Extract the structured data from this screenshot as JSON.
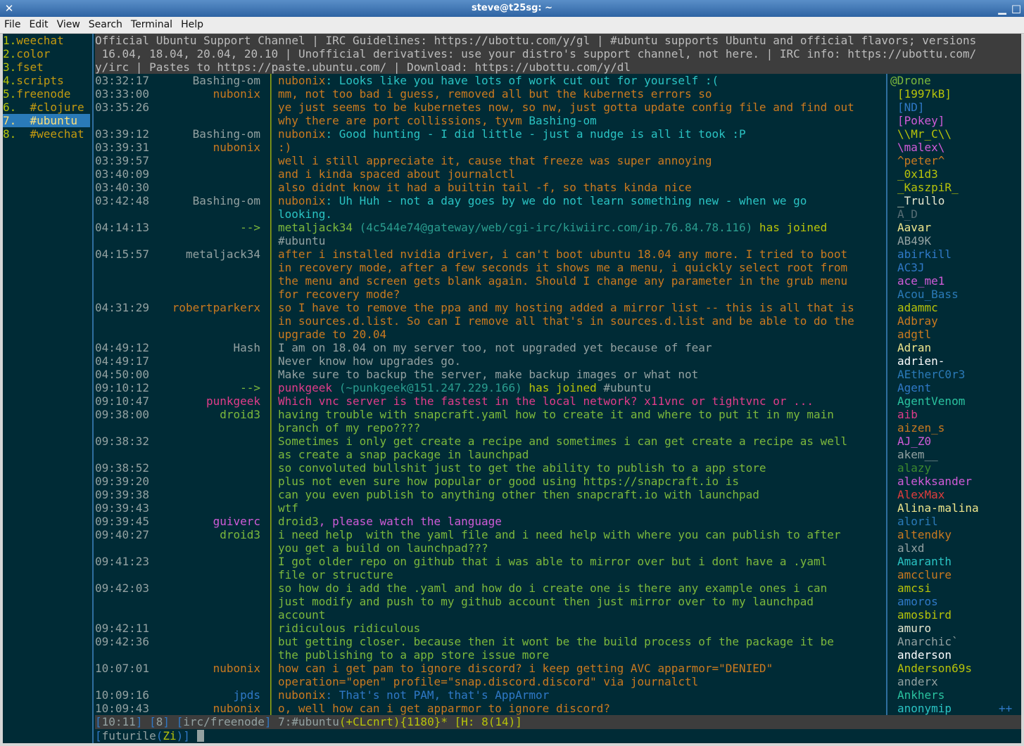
{
  "window": {
    "title": "steve@t25sg: ~"
  },
  "menu": [
    "File",
    "Edit",
    "View",
    "Search",
    "Terminal",
    "Help"
  ],
  "buffers": [
    {
      "num": "1.",
      "name": "weechat"
    },
    {
      "num": "2.",
      "name": "color"
    },
    {
      "num": "3.",
      "name": "fset"
    },
    {
      "num": "4.",
      "name": "scripts"
    },
    {
      "num": "5.",
      "name": "freenode"
    },
    {
      "num": "6.",
      "name": "  #clojure"
    },
    {
      "num": "7.",
      "name": "  #ubuntu ",
      "active": true
    },
    {
      "num": "8.",
      "name": "  #weechat"
    }
  ],
  "topic": [
    "Official Ubuntu Support Channel | IRC Guidelines: https://ubottu.com/y/gl | #ubuntu supports Ubuntu and official flavors; versions",
    " 16.04, 18.04, 20.04, 20.10 | Unofficial derivatives: use your distro's support channel, not here. | IRC info: https://ubottu.com/",
    "y/irc | Pastes to https://paste.ubuntu.com/ | Download: https://ubottu.com/y/dl"
  ],
  "lines": [
    {
      "t": "03:32:17",
      "n": "Bashing-om",
      "nc": "c-bash",
      "m": [
        [
          "nubonix",
          "c-nub"
        ],
        [
          ": Looks like you have lots of work cut out for yourself :(",
          "c-cyan"
        ]
      ]
    },
    {
      "t": "03:33:00",
      "n": "nubonix",
      "nc": "c-nub",
      "m": [
        [
          "mm, not too bad i guess, removed all but the kubernets errors so",
          "c-nub"
        ]
      ]
    },
    {
      "t": "03:35:26",
      "n": "",
      "nc": "c-nub",
      "m": [
        [
          "ye just seems to be kubernetes now, so nw, just gotta update config file and find out",
          "c-nub"
        ]
      ]
    },
    {
      "t": "",
      "n": "",
      "nc": "c-nub",
      "m": [
        [
          "why there are port collissions, tyvm ",
          "c-nub"
        ],
        [
          "Bashing-om",
          "c-hl"
        ]
      ]
    },
    {
      "t": "03:39:12",
      "n": "Bashing-om",
      "nc": "c-bash",
      "m": [
        [
          "nubonix",
          "c-nub"
        ],
        [
          ": Good hunting - I did little - just a nudge is all it took :P",
          "c-cyan"
        ]
      ]
    },
    {
      "t": "03:39:31",
      "n": "nubonix",
      "nc": "c-nub",
      "m": [
        [
          ":)",
          "c-nub"
        ]
      ]
    },
    {
      "t": "03:39:57",
      "n": "",
      "nc": "c-nub",
      "m": [
        [
          "well i still appreciate it, cause that freeze was super annoying",
          "c-nub"
        ]
      ]
    },
    {
      "t": "03:40:09",
      "n": "",
      "nc": "c-nub",
      "m": [
        [
          "and i kinda spaced about journalctl",
          "c-nub"
        ]
      ]
    },
    {
      "t": "03:40:30",
      "n": "",
      "nc": "c-nub",
      "m": [
        [
          "also didnt know it had a builtin tail -f, so thats kinda nice",
          "c-nub"
        ]
      ]
    },
    {
      "t": "03:42:48",
      "n": "Bashing-om",
      "nc": "c-bash",
      "m": [
        [
          "nubonix",
          "c-nub"
        ],
        [
          ": Uh Huh - not a day goes by we do not learn something new - when we go",
          "c-cyan"
        ]
      ]
    },
    {
      "t": "",
      "n": "",
      "nc": "c-bash",
      "m": [
        [
          "looking.",
          "c-cyan"
        ]
      ]
    },
    {
      "t": "04:14:13",
      "n": "-->",
      "nc": "c-arrow",
      "m": [
        [
          "metaljack34 ",
          "c-droid"
        ],
        [
          "(4c544e74@gateway/web/cgi-irc/kiwiirc.com/ip.76.84.78.116)",
          "c-join-host"
        ],
        [
          " has joined",
          "c-join"
        ]
      ]
    },
    {
      "t": "",
      "n": "",
      "nc": "c-arrow",
      "m": [
        [
          "#ubuntu",
          "c-grey"
        ]
      ]
    },
    {
      "t": "04:15:57",
      "n": "metaljack34",
      "nc": "c-metal",
      "m": [
        [
          "after i installed nvidia driver, i can't boot ubuntu 18.04 any more. I tried to boot",
          "c-nub"
        ]
      ]
    },
    {
      "t": "",
      "n": "",
      "nc": "c-metal",
      "m": [
        [
          "in recovery mode, after a few seconds it shows me a menu, i quickly select root from",
          "c-nub"
        ]
      ]
    },
    {
      "t": "",
      "n": "",
      "nc": "c-metal",
      "m": [
        [
          "the menu and screen gets blank again. Should I change any parameter in the grub menu",
          "c-nub"
        ]
      ]
    },
    {
      "t": "",
      "n": "",
      "nc": "c-metal",
      "m": [
        [
          "for recovery mode?",
          "c-nub"
        ]
      ]
    },
    {
      "t": "04:31:29",
      "n": "robertparkerx",
      "nc": "c-rob",
      "m": [
        [
          "so I have to remove the ppa and my hosting added a mirror list -- this is all that is",
          "c-nub"
        ]
      ]
    },
    {
      "t": "",
      "n": "",
      "nc": "c-rob",
      "m": [
        [
          "in sources.d.list. So can I remove all that's in sources.d.list and be able to do the",
          "c-nub"
        ]
      ]
    },
    {
      "t": "",
      "n": "",
      "nc": "c-rob",
      "m": [
        [
          "upgrade to 20.04",
          "c-nub"
        ]
      ]
    },
    {
      "t": "04:49:12",
      "n": "Hash",
      "nc": "c-hash",
      "m": [
        [
          "I am on 18.04 on my server too, not upgraded yet because of fear",
          "c-grey"
        ]
      ]
    },
    {
      "t": "04:49:17",
      "n": "",
      "nc": "c-hash",
      "m": [
        [
          "Never know how upgrades go.",
          "c-grey"
        ]
      ]
    },
    {
      "t": "04:50:00",
      "n": "",
      "nc": "c-hash",
      "m": [
        [
          "Make sure to backup the server, make backup images or what not",
          "c-grey"
        ]
      ]
    },
    {
      "t": "09:10:12",
      "n": "-->",
      "nc": "c-arrow",
      "m": [
        [
          "punkgeek ",
          "c-punk"
        ],
        [
          "(~punkgeek@151.247.229.166)",
          "c-join-host"
        ],
        [
          " has joined ",
          "c-join"
        ],
        [
          "#ubuntu",
          "c-grey"
        ]
      ]
    },
    {
      "t": "09:10:47",
      "n": "punkgeek",
      "nc": "c-punk",
      "m": [
        [
          "Which vnc server is the fastest in the local network? x11vnc or tightvnc or ...",
          "c-punk"
        ]
      ]
    },
    {
      "t": "09:38:00",
      "n": "droid3",
      "nc": "c-droid",
      "m": [
        [
          "having trouble with snapcraft.yaml how to create it and where to put it in my main",
          "c-droid"
        ]
      ]
    },
    {
      "t": "",
      "n": "",
      "nc": "c-droid",
      "m": [
        [
          "branch of my repo????",
          "c-droid"
        ]
      ]
    },
    {
      "t": "09:38:32",
      "n": "",
      "nc": "c-droid",
      "m": [
        [
          "Sometimes i only get create a recipe and sometimes i can get create a recipe as well",
          "c-droid"
        ]
      ]
    },
    {
      "t": "",
      "n": "",
      "nc": "c-droid",
      "m": [
        [
          "as create a snap package in launchpad",
          "c-droid"
        ]
      ]
    },
    {
      "t": "09:38:52",
      "n": "",
      "nc": "c-droid",
      "m": [
        [
          "so convoluted bullshit just to get the ability to publish to a app store",
          "c-droid"
        ]
      ]
    },
    {
      "t": "09:39:20",
      "n": "",
      "nc": "c-droid",
      "m": [
        [
          "plus not even sure how popular or good using https://snapcraft.io is",
          "c-droid"
        ]
      ]
    },
    {
      "t": "09:39:38",
      "n": "",
      "nc": "c-droid",
      "m": [
        [
          "can you even publish to anything other then snapcraft.io with launchpad",
          "c-droid"
        ]
      ]
    },
    {
      "t": "09:39:43",
      "n": "",
      "nc": "c-droid",
      "m": [
        [
          "wtf",
          "c-droid"
        ]
      ]
    },
    {
      "t": "09:39:45",
      "n": "guiverc",
      "nc": "c-gui",
      "m": [
        [
          "droid3",
          "c-droid"
        ],
        [
          ", please watch the language",
          "c-gui"
        ]
      ]
    },
    {
      "t": "09:40:27",
      "n": "droid3",
      "nc": "c-droid",
      "m": [
        [
          "i need help  with the yaml file and i need help with where you can publish to after",
          "c-droid"
        ]
      ]
    },
    {
      "t": "",
      "n": "",
      "nc": "c-droid",
      "m": [
        [
          "you get a build on launchpad???",
          "c-droid"
        ]
      ]
    },
    {
      "t": "09:41:23",
      "n": "",
      "nc": "c-droid",
      "m": [
        [
          "I got older repo on github that i was able to mirror over but i dont have a .yaml",
          "c-droid"
        ]
      ]
    },
    {
      "t": "",
      "n": "",
      "nc": "c-droid",
      "m": [
        [
          "file or structure",
          "c-droid"
        ]
      ]
    },
    {
      "t": "09:42:03",
      "n": "",
      "nc": "c-droid",
      "m": [
        [
          "so how do i add the .yaml and how do i create one is there any example ones i can",
          "c-droid"
        ]
      ]
    },
    {
      "t": "",
      "n": "",
      "nc": "c-droid",
      "m": [
        [
          "just modify and push to my github account then just mirror over to my launchpad",
          "c-droid"
        ]
      ]
    },
    {
      "t": "",
      "n": "",
      "nc": "c-droid",
      "m": [
        [
          "account",
          "c-droid"
        ]
      ]
    },
    {
      "t": "09:42:11",
      "n": "",
      "nc": "c-droid",
      "m": [
        [
          "ridiculous ridiculous",
          "c-droid"
        ]
      ]
    },
    {
      "t": "09:42:36",
      "n": "",
      "nc": "c-droid",
      "m": [
        [
          "but getting closer. because then it wont be the build process of the package it be",
          "c-droid"
        ]
      ]
    },
    {
      "t": "",
      "n": "",
      "nc": "c-droid",
      "m": [
        [
          "the publishing to a app store issue more",
          "c-droid"
        ]
      ]
    },
    {
      "t": "10:07:01",
      "n": "nubonix",
      "nc": "c-nub",
      "m": [
        [
          "how can i get pam to ignore discord? i keep getting AVC apparmor=\"DENIED\"",
          "c-nub"
        ]
      ]
    },
    {
      "t": "",
      "n": "",
      "nc": "c-nub",
      "m": [
        [
          "operation=\"open\" profile=\"snap.discord.discord\" via journalctl",
          "c-nub"
        ]
      ]
    },
    {
      "t": "10:09:16",
      "n": "jpds",
      "nc": "c-jp",
      "m": [
        [
          "nubonix",
          "c-nub"
        ],
        [
          ": That's not PAM, that's AppArmor",
          "c-jp"
        ]
      ]
    },
    {
      "t": "10:09:43",
      "n": "nubonix",
      "nc": "c-nub",
      "m": [
        [
          "o, well how can i get apparmor to ignore discord?",
          "c-nub"
        ]
      ]
    }
  ],
  "nicks": [
    {
      "n": "@Drone",
      "c": "#7db93c",
      "op": true
    },
    {
      "n": "[1997kB]",
      "c": "#b7c30a"
    },
    {
      "n": "[ND]",
      "c": "#2f79c7"
    },
    {
      "n": "[Pokey]",
      "c": "#d05bd8"
    },
    {
      "n": "\\\\Mr_C\\\\",
      "c": "#b7c30a"
    },
    {
      "n": "\\malex\\",
      "c": "#d05bd8"
    },
    {
      "n": "^peter^",
      "c": "#cb7a1f"
    },
    {
      "n": "_0x1d3",
      "c": "#b7c30a"
    },
    {
      "n": "_KaszpiR_",
      "c": "#b7c30a"
    },
    {
      "n": "_Trullo",
      "c": "#e8e8d0"
    },
    {
      "n": "A_D",
      "c": "#586e75"
    },
    {
      "n": "Aavar",
      "c": "#f0e68c"
    },
    {
      "n": "AB49K",
      "c": "#93a1a1"
    },
    {
      "n": "abirkill",
      "c": "#2f79c7"
    },
    {
      "n": "AC3J",
      "c": "#2f79c7"
    },
    {
      "n": "ace_me1",
      "c": "#d05bd8"
    },
    {
      "n": "Acou_Bass",
      "c": "#2a7ab8"
    },
    {
      "n": "adammc",
      "c": "#b7c30a"
    },
    {
      "n": "Adbray",
      "c": "#cb7a1f"
    },
    {
      "n": "adgtl",
      "c": "#cb7a1f"
    },
    {
      "n": "Adran",
      "c": "#f0e68c"
    },
    {
      "n": "adrien-",
      "c": "#ffffff"
    },
    {
      "n": "AEtherC0r3",
      "c": "#2a7ab8"
    },
    {
      "n": "Agent",
      "c": "#2f79c7"
    },
    {
      "n": "AgentVenom",
      "c": "#2ac3a0"
    },
    {
      "n": "aib",
      "c": "#e03c8a"
    },
    {
      "n": "aizen_s",
      "c": "#cb7a1f"
    },
    {
      "n": "AJ_Z0",
      "c": "#d05bd8"
    },
    {
      "n": "akem__",
      "c": "#93a1a1"
    },
    {
      "n": "alazy",
      "c": "#3c8a2e"
    },
    {
      "n": "alekksander",
      "c": "#d05bd8"
    },
    {
      "n": "AlexMax",
      "c": "#e03c3c"
    },
    {
      "n": "Alina-malina",
      "c": "#f0e68c"
    },
    {
      "n": "aloril",
      "c": "#2a7ab8"
    },
    {
      "n": "altendky",
      "c": "#cb7a1f"
    },
    {
      "n": "alxd",
      "c": "#93a1a1"
    },
    {
      "n": "Amaranth",
      "c": "#2ac3c3"
    },
    {
      "n": "amcclure",
      "c": "#cb7a1f"
    },
    {
      "n": "amcsi",
      "c": "#b7c30a"
    },
    {
      "n": "amoros",
      "c": "#2f79c7"
    },
    {
      "n": "amosbird",
      "c": "#b7c30a"
    },
    {
      "n": "amuro",
      "c": "#e8e8d0"
    },
    {
      "n": "Anarchic`",
      "c": "#93a1a1"
    },
    {
      "n": "anderson",
      "c": "#ffffff"
    },
    {
      "n": "Anderson69s",
      "c": "#b7c30a"
    },
    {
      "n": "anderx",
      "c": "#93a1a1"
    },
    {
      "n": "Ankhers",
      "c": "#2ac3a0"
    },
    {
      "n": "anonymip",
      "c": "#2ac3c3"
    }
  ],
  "more_indicator": "++",
  "status": {
    "time": "10:11",
    "bufnum": "8",
    "server": "irc/freenode",
    "channel": "7:#ubuntu",
    "modes": "(+CLcnrt)",
    "count": "{1180}",
    "star": "*",
    "hot": "[H: 8(14)]"
  },
  "input": {
    "nick": "futurile",
    "mode": "Zi"
  }
}
